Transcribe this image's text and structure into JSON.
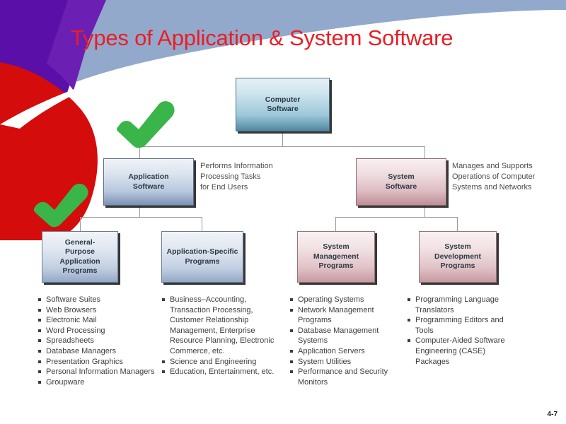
{
  "slide": {
    "title": "Types of Application & System Software",
    "page_number": "4-7",
    "title_color": "#ec1c24",
    "check_color": "#39b54a"
  },
  "diagram": {
    "root": {
      "label": "Computer\nSoftware"
    },
    "level2": [
      {
        "label": "Application\nSoftware",
        "annotation": "Performs Information\nProcessing Tasks\nfor End Users"
      },
      {
        "label": "System\nSoftware",
        "annotation": "Manages and Supports\nOperations of Computer\nSystems and Networks"
      }
    ],
    "level3": [
      {
        "label": "General-\nPurpose\nApplication\nPrograms"
      },
      {
        "label": "Application-Specific\nPrograms"
      },
      {
        "label": "System\nManagement\nPrograms"
      },
      {
        "label": "System\nDevelopment\nPrograms"
      }
    ]
  },
  "lists": {
    "general_purpose": [
      "Software Suites",
      "Web Browsers",
      "Electronic Mail",
      "Word Processing",
      "Spreadsheets",
      "Database Managers",
      "Presentation Graphics",
      "Personal Information Managers",
      "Groupware"
    ],
    "application_specific": [
      "Business–Accounting, Transaction Processing, Customer Relationship Management, Enterprise Resource Planning, Electronic Commerce, etc.",
      "Science and Engineering",
      "Education, Entertainment, etc."
    ],
    "system_management": [
      "Operating Systems",
      "Network Management Programs",
      "Database Management Systems",
      "Application Servers",
      "System Utilities",
      "Performance and Security Monitors"
    ],
    "system_development": [
      "Programming Language Translators",
      "Programming Editors and Tools",
      "Computer-Aided Software Engineering (CASE) Packages"
    ]
  }
}
